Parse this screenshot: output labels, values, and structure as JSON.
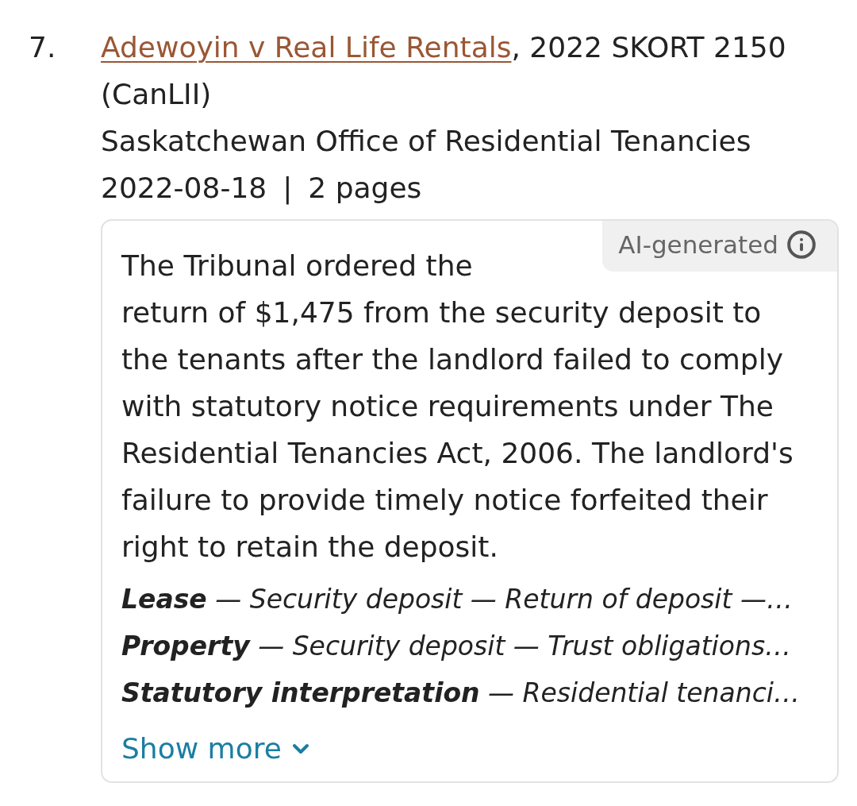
{
  "result": {
    "number": "7.",
    "title_link": "Adewoyin v Real Life Rentals",
    "citation": ", 2022 SKORT 2150 (CanLII)",
    "court": "Saskatchewan Office of Residential Tenancies",
    "date": "2022-08-18",
    "separator": "|",
    "pages": "2 pages",
    "summary": {
      "badge": "AI-generated",
      "text": "The Tribunal ordered the return of $1,475 from the security deposit to the tenants after the landlord failed to comply with statutory notice requirements under The Residential Tenancies Act, 2006. The landlord's failure to provide timely notice forfeited their right to retain the deposit.",
      "keywords": [
        "**Lease** — Security deposit — Return of deposit —…",
        "**Property** — Security deposit — Trust obligations…",
        "**Statutory interpretation** — Residential tenanci…"
      ],
      "show_more": "Show more",
      "expanded": false
    }
  }
}
